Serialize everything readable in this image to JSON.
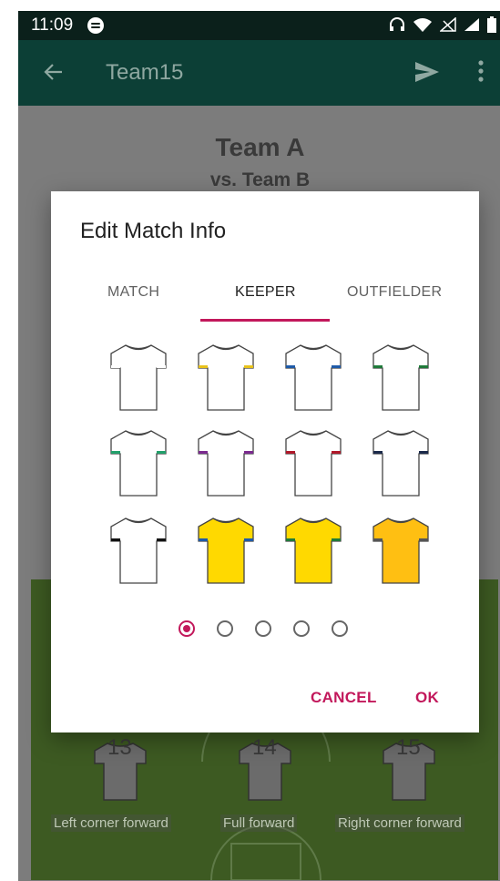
{
  "status_bar": {
    "time": "11:09"
  },
  "app_bar": {
    "title": "Team15"
  },
  "background": {
    "team_name": "Team A",
    "opponent": "vs. Team B",
    "players": [
      {
        "number": "13",
        "label": "Left corner forward"
      },
      {
        "number": "14",
        "label": "Full forward"
      },
      {
        "number": "15",
        "label": "Right corner forward"
      }
    ]
  },
  "dialog": {
    "title": "Edit Match Info",
    "tabs": [
      {
        "label": "MATCH",
        "active": false
      },
      {
        "label": "KEEPER",
        "active": true
      },
      {
        "label": "OUTFIELDER",
        "active": false
      }
    ],
    "jerseys": [
      {
        "body": "#ffffff",
        "trim": "#ffffff"
      },
      {
        "body": "#ffffff",
        "trim": "#e8c21a"
      },
      {
        "body": "#ffffff",
        "trim": "#1e5aa8"
      },
      {
        "body": "#ffffff",
        "trim": "#1f7a3a"
      },
      {
        "body": "#ffffff",
        "trim": "#22a06b"
      },
      {
        "body": "#ffffff",
        "trim": "#7b2a8f"
      },
      {
        "body": "#ffffff",
        "trim": "#b0182a"
      },
      {
        "body": "#ffffff",
        "trim": "#1b2a4a"
      },
      {
        "body": "#ffffff",
        "trim": "#111111"
      },
      {
        "body": "#ffd900",
        "trim": "#1e5aa8"
      },
      {
        "body": "#ffd900",
        "trim": "#1f7a3a"
      },
      {
        "body": "#ffbf12",
        "trim": "#555555"
      },
      {
        "body": "#ffd900",
        "trim": "#ffd900"
      },
      {
        "body": "#ffbf12",
        "trim": "#ffbf12"
      },
      {
        "body": "#ffbf12",
        "trim": "#ffbf12"
      },
      {
        "body": "#a6e07a",
        "trim": "#a6e07a"
      }
    ],
    "pages": {
      "total": 5,
      "current": 1
    },
    "cancel_label": "CANCEL",
    "ok_label": "OK"
  },
  "colors": {
    "accent": "#c2185b",
    "app_bar": "#0c3f36",
    "status_bar": "#0b201b"
  }
}
